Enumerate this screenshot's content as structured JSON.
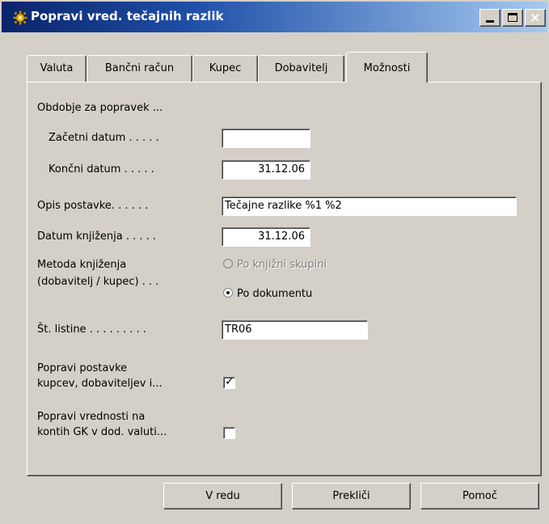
{
  "window": {
    "title": "Popravi vred. tečajnih razlik",
    "icon": "gear-icon",
    "controls": {
      "minimize": "minimize",
      "maximize": "maximize",
      "close": "×"
    }
  },
  "tabs": [
    {
      "label": "Valuta",
      "active": false
    },
    {
      "label": "Bančni račun",
      "active": false
    },
    {
      "label": "Kupec",
      "active": false
    },
    {
      "label": "Dobavitelj",
      "active": false
    },
    {
      "label": "Možnosti",
      "active": true
    }
  ],
  "form": {
    "period_heading": "Obdobje za popravek ...",
    "start_date": {
      "label": "Začetni datum . . . . .",
      "value": ""
    },
    "end_date": {
      "label": "Končni datum . . . . .",
      "value": "31.12.06"
    },
    "description": {
      "label": "Opis postavke. . . . . .",
      "value": "Tečajne razlike %1 %2"
    },
    "posting_date": {
      "label": "Datum knjiženja . . . . .",
      "value": "31.12.06"
    },
    "posting_method": {
      "label_line1": "Metoda knjiženja",
      "label_line2": "(dobavitelj / kupec) . . .",
      "options": [
        {
          "label": "Po knjižni skupini",
          "selected": false,
          "enabled": false
        },
        {
          "label": "Po dokumentu",
          "selected": true,
          "enabled": true
        }
      ]
    },
    "document_no": {
      "label": "Št. listine . . . . . . . . .",
      "value": "TR06"
    },
    "adjust_entries": {
      "label": "Popravi postavke\nkupcev, dobaviteljev i...",
      "checked": true
    },
    "adjust_gl": {
      "label": "Popravi vrednosti na\nkontih GK v dod. valuti...",
      "checked": false
    }
  },
  "buttons": {
    "ok": "V redu",
    "cancel": "Prekliči",
    "help": "Pomoč"
  },
  "colors": {
    "face": "#d4d0c8",
    "titlebar_start": "#0a246a",
    "titlebar_end": "#a6caf0"
  }
}
